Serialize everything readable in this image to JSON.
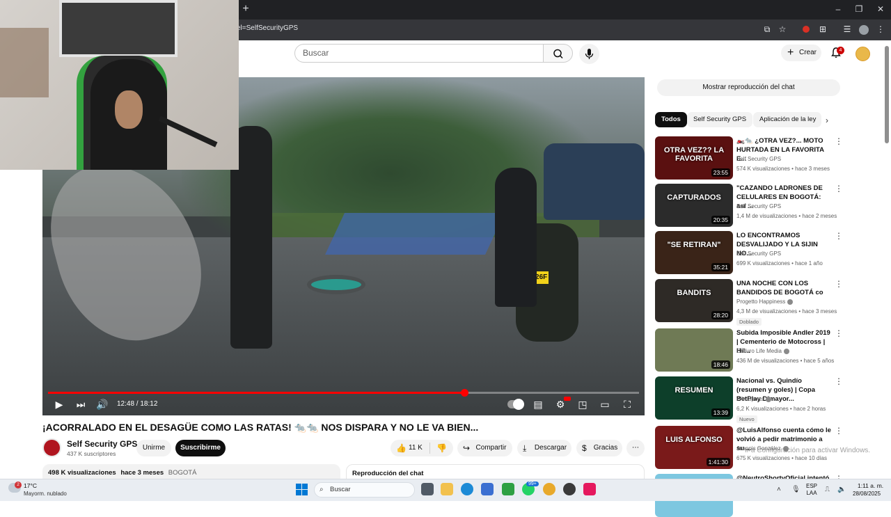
{
  "browser": {
    "url_fragment": "el=SelfSecurityGPS",
    "new_tab_label": "+",
    "window_controls": [
      "–",
      "❐",
      "✕"
    ]
  },
  "header": {
    "search_placeholder": "Buscar",
    "create_label": "Crear",
    "notification_count": "4"
  },
  "player": {
    "current_time": "12:48 / 18:12",
    "progress": 0.704,
    "plate_text": "JMZ-26F"
  },
  "video": {
    "title": "¡ACORRALADO EN EL DESAGÜE COMO LAS RATAS! 🐀🐀 NOS DISPARA Y NO LE VA BIEN...",
    "channel_name": "Self Security GPS",
    "subscribers": "437 K suscriptores",
    "join_label": "Unirme",
    "subscribe_label": "Suscribirme",
    "likes": "11 K",
    "share_label": "Compartir",
    "download_label": "Descargar",
    "thanks_label": "Gracias",
    "views": "498 K visualizaciones",
    "age": "hace 3 meses",
    "location_tag": "BOGOTÁ",
    "chat_replay_label": "Reproducción del chat"
  },
  "sidebar": {
    "chat_toggle_label": "Mostrar reproducción del chat",
    "chips": [
      "Todos",
      "Self Security GPS",
      "Aplicación de la ley"
    ],
    "recommendations": [
      {
        "title": "🏍️🐀 ¿OTRA VEZ?... MOTO HURTADA EN LA  FAVORITA E...",
        "channel": "Self Security GPS",
        "meta": "574 K visualizaciones • hace 3 meses",
        "duration": "23:55",
        "thumb_text": "OTRA VEZ?? LA FAVORITA",
        "thumb_color": "#5a1010",
        "verified": false,
        "badge": ""
      },
      {
        "title": "\"CAZANDO LADRONES DE CELULARES EN BOGOTÁ: así ...",
        "channel": "Self Security GPS",
        "meta": "1,4 M de visualizaciones • hace 2 meses",
        "duration": "20:35",
        "thumb_text": "CAPTURADOS",
        "thumb_color": "#2b2b2b",
        "verified": false,
        "badge": ""
      },
      {
        "title": "LO ENCONTRAMOS DESVALIJADO Y LA SIJIN NO...",
        "channel": "Self Security GPS",
        "meta": "699 K visualizaciones • hace 1 año",
        "duration": "35:21",
        "thumb_text": "\"SE RETIRAN\"",
        "thumb_color": "#3a2418",
        "verified": false,
        "badge": ""
      },
      {
        "title": "UNA NOCHE CON LOS BANDIDOS DE BOGOTÁ co",
        "channel": "Progetto Happiness",
        "meta": "4,3 M de visualizaciones • hace 3 meses",
        "duration": "28:20",
        "thumb_text": "BANDITS",
        "thumb_color": "#2e2a26",
        "verified": true,
        "badge": "Doblado"
      },
      {
        "title": "Subida Imposible Andler 2019 | Cementerio de Motocross | Hil...",
        "channel": "Enduro Life Media",
        "meta": "436 M de visualizaciones • hace 5 años",
        "duration": "18:46",
        "thumb_text": "",
        "thumb_color": "#6f7a55",
        "verified": true,
        "badge": ""
      },
      {
        "title": "Nacional vs. Quindío (resumen y goles) | Copa BetPlay Dimayor...",
        "channel": "Win Sports",
        "meta": "6,2 K visualizaciones • hace 2 horas",
        "duration": "13:39",
        "thumb_text": "RESUMEN",
        "thumb_color": "#0d3f2a",
        "verified": true,
        "badge": "Nuevo"
      },
      {
        "title": "@LuisAlfonso cuenta cómo le volvió a pedir matrimonio a su ...",
        "channel": "Juanpis González",
        "meta": "675 K visualizaciones • hace 10 días",
        "duration": "1:41:30",
        "thumb_text": "LUIS ALFONSO",
        "thumb_color": "#7a1a1a",
        "verified": true,
        "badge": ""
      },
      {
        "title": "@NeutroShortyOficial intentó",
        "channel": "",
        "meta": "",
        "duration": "",
        "thumb_text": "",
        "thumb_color": "#7dc7e0",
        "verified": false,
        "badge": ""
      }
    ]
  },
  "watermark": "Ir a Configuración para activar Windows.",
  "taskbar": {
    "weather_temp": "17°C",
    "weather_desc": "Mayorm. nublado",
    "weather_badge": "2",
    "search_label": "Buscar",
    "app_badge": "99+",
    "lang": "ESP",
    "lang_sub": "LAA",
    "time": "1:11 a. m.",
    "date": "28/08/2025"
  }
}
